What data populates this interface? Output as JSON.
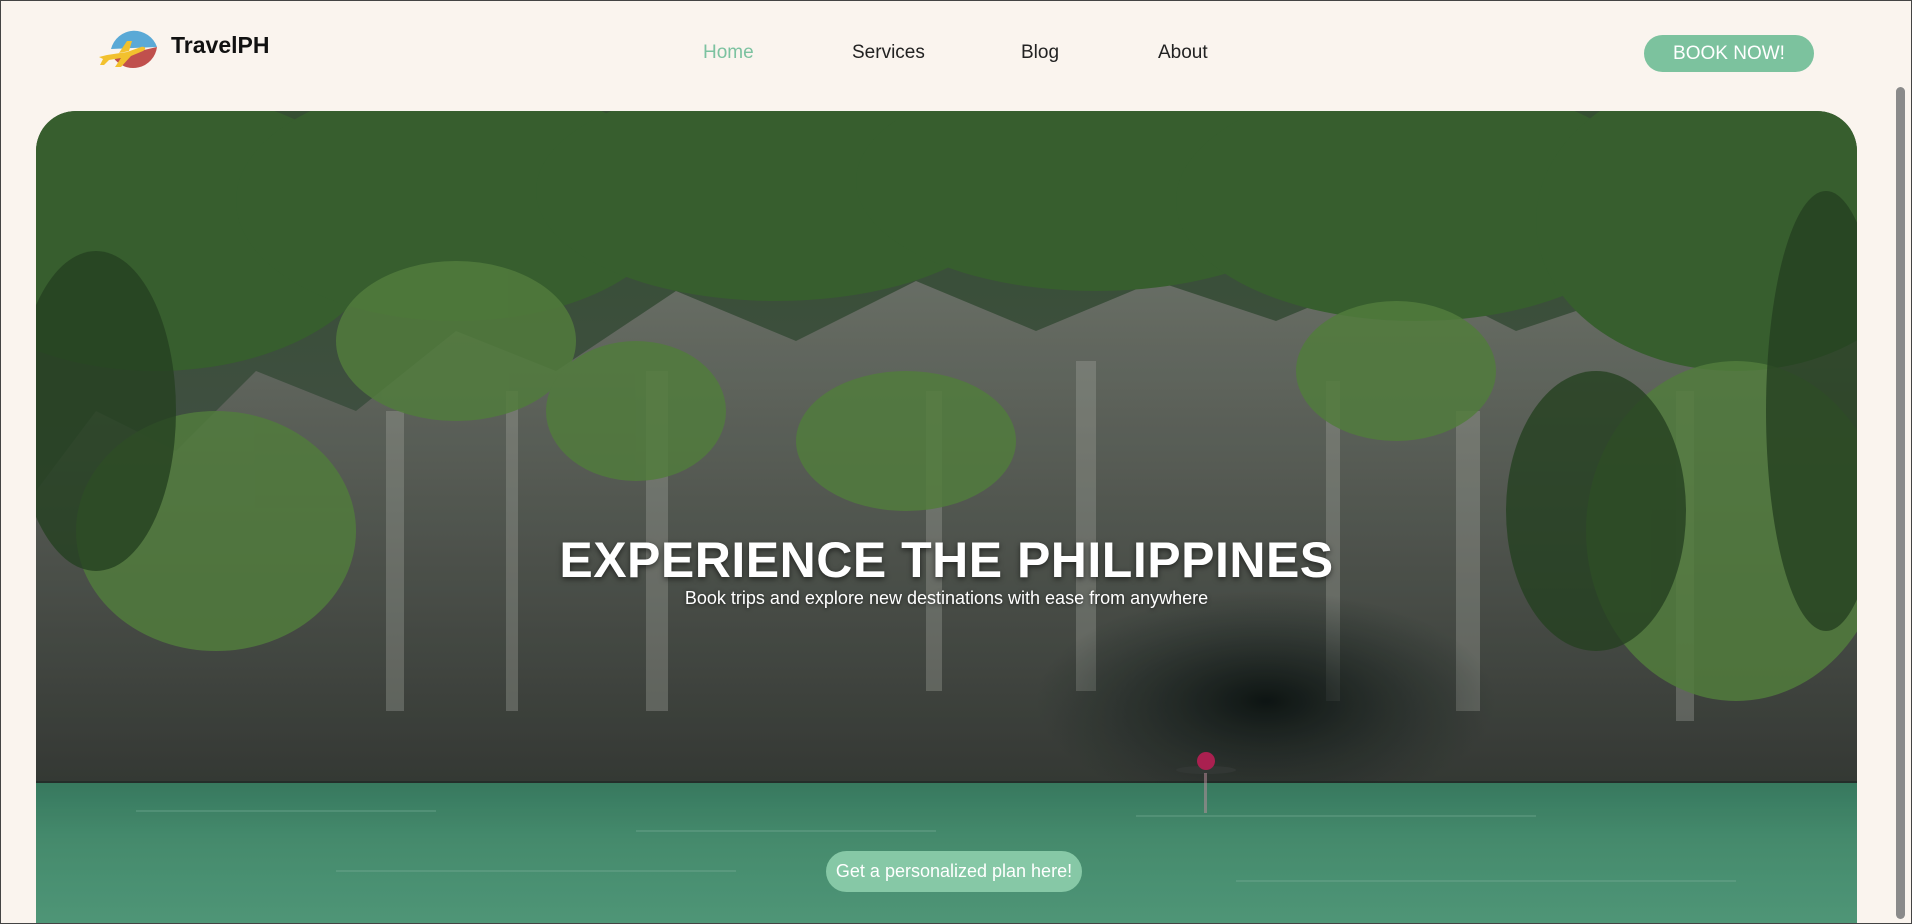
{
  "header": {
    "brand": "TravelPH",
    "nav": [
      {
        "label": "Home",
        "active": true
      },
      {
        "label": "Services",
        "active": false
      },
      {
        "label": "Blog",
        "active": false
      },
      {
        "label": "About",
        "active": false
      }
    ],
    "cta_label": "BOOK NOW!"
  },
  "hero": {
    "title": "EXPERIENCE THE PHILIPPINES",
    "subtitle": "Book trips and explore new destinations with ease from anywhere",
    "plan_button": "Get a personalized plan here!",
    "image_icon": "jungle-cave-river-photo"
  },
  "colors": {
    "accent": "#7cc29e",
    "background": "#faf4ee",
    "active_nav": "#7cc2a0",
    "logo_blue": "#5aa9d6",
    "logo_red": "#c0504d",
    "logo_plane": "#f2c12e"
  }
}
